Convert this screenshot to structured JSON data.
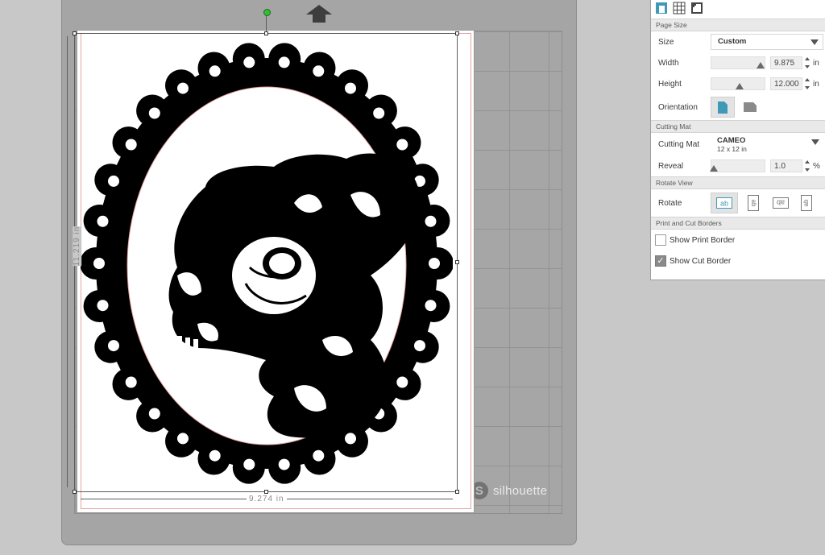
{
  "canvas": {
    "width_dimension": "9.274 in",
    "height_dimension": "11.219 in",
    "mat_brand": "silhouette",
    "mat_brand_logo": "S"
  },
  "panel": {
    "tabs": [
      {
        "icon": "page-setup-icon"
      },
      {
        "icon": "grid-icon"
      },
      {
        "icon": "registration-marks-icon"
      }
    ],
    "page_size": {
      "section_title": "Page Size",
      "size_label": "Size",
      "size_value": "Custom",
      "width_label": "Width",
      "width_value": "9.875",
      "width_unit": "in",
      "height_label": "Height",
      "height_value": "12.000",
      "height_unit": "in",
      "orientation_label": "Orientation"
    },
    "cutting_mat": {
      "section_title": "Cutting Mat",
      "label": "Cutting Mat",
      "value": "CAMEO",
      "value_sub": "12 x 12 in",
      "reveal_label": "Reveal",
      "reveal_value": "1.0",
      "reveal_unit": "%"
    },
    "rotate_view": {
      "section_title": "Rotate View",
      "label": "Rotate",
      "options": [
        "ab",
        "ab",
        "ab",
        "ab"
      ]
    },
    "borders": {
      "section_title": "Print and Cut Borders",
      "show_print_border": "Show Print Border",
      "show_print_border_checked": false,
      "show_cut_border": "Show Cut Border",
      "show_cut_border_checked": true
    }
  },
  "colors": {
    "accent": "#3f9ab8",
    "selection_handle": "#2fbf2f",
    "cut_border": "#e5a4a4"
  }
}
